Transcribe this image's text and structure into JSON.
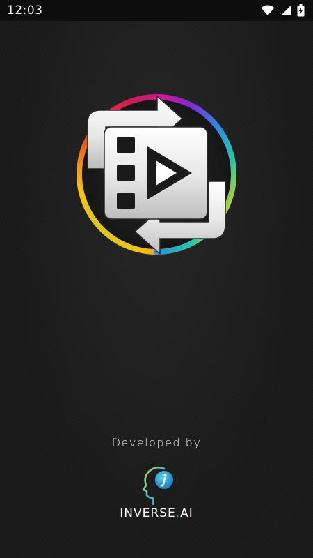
{
  "status_bar": {
    "time": "12:03",
    "icons": [
      "wifi-icon",
      "cell-signal-icon",
      "battery-charging-icon"
    ]
  },
  "splash": {
    "app_logo": "video-convert-icon",
    "colors": {
      "background": "#1b1b1b",
      "status_bar": "#0d0d0d",
      "brand_accent": "#1ea7c9"
    }
  },
  "footer": {
    "developed_by": "Developed by",
    "brand_prefix": "INVERSE",
    "brand_dot": ".",
    "brand_suffix": "AI",
    "brand_logo": "head-i-logo-icon"
  }
}
